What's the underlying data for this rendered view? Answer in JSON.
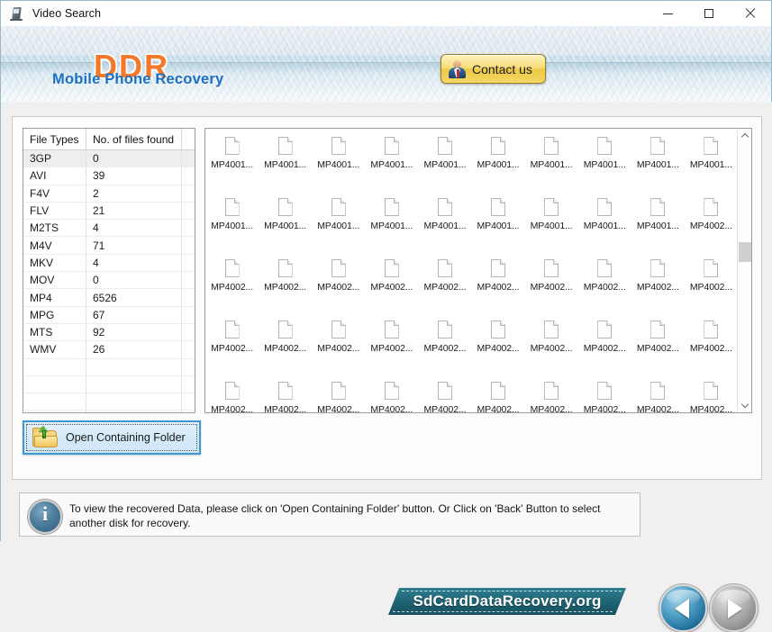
{
  "window": {
    "title": "Video Search",
    "icon": "video-search-icon",
    "controls": {
      "minimize": "minimize",
      "maximize": "maximize",
      "close": "close"
    }
  },
  "header": {
    "logo": "DDR",
    "subtitle": "Mobile Phone Recovery",
    "contact_label": "Contact us",
    "accent_orange": "#f4782a",
    "accent_blue": "#1a6fc4"
  },
  "file_table": {
    "columns": [
      "File Types",
      "No. of files found",
      ""
    ],
    "rows": [
      {
        "type": "3GP",
        "count": "0",
        "selected": true
      },
      {
        "type": "AVI",
        "count": "39",
        "selected": false
      },
      {
        "type": "F4V",
        "count": "2",
        "selected": false
      },
      {
        "type": "FLV",
        "count": "21",
        "selected": false
      },
      {
        "type": "M2TS",
        "count": "4",
        "selected": false
      },
      {
        "type": "M4V",
        "count": "71",
        "selected": false
      },
      {
        "type": "MKV",
        "count": "4",
        "selected": false
      },
      {
        "type": "MOV",
        "count": "0",
        "selected": false
      },
      {
        "type": "MP4",
        "count": "6526",
        "selected": false
      },
      {
        "type": "MPG",
        "count": "67",
        "selected": false
      },
      {
        "type": "MTS",
        "count": "92",
        "selected": false
      },
      {
        "type": "WMV",
        "count": "26",
        "selected": false
      }
    ],
    "empty_rows": 6
  },
  "open_folder_button": {
    "label": "Open Containing Folder",
    "icon": "open-folder-icon"
  },
  "file_grid": {
    "columns": 10,
    "names": [
      "MP4001...",
      "MP4001...",
      "MP4001...",
      "MP4001...",
      "MP4001...",
      "MP4001...",
      "MP4001...",
      "MP4001...",
      "MP4001...",
      "MP4001...",
      "MP4001...",
      "MP4001...",
      "MP4001...",
      "MP4001...",
      "MP4001...",
      "MP4001...",
      "MP4001...",
      "MP4001...",
      "MP4001...",
      "MP4002...",
      "MP4002...",
      "MP4002...",
      "MP4002...",
      "MP4002...",
      "MP4002...",
      "MP4002...",
      "MP4002...",
      "MP4002...",
      "MP4002...",
      "MP4002...",
      "MP4002...",
      "MP4002...",
      "MP4002...",
      "MP4002...",
      "MP4002...",
      "MP4002...",
      "MP4002...",
      "MP4002...",
      "MP4002...",
      "MP4002...",
      "MP4002...",
      "MP4002...",
      "MP4002...",
      "MP4002...",
      "MP4002...",
      "MP4002...",
      "MP4002...",
      "MP4002...",
      "MP4002...",
      "MP4002...",
      "MP4002...",
      "MP4002...",
      "MP4002...",
      "MP4002...",
      "MP4002...",
      "MP4002...",
      "MP4002...",
      "MP4002...",
      "MP4002...",
      "MP4002..."
    ],
    "scrollbar": {
      "up": "scroll-up",
      "down": "scroll-down",
      "thumb_position": "40%"
    }
  },
  "info": {
    "icon": "info-icon",
    "text": "To view the recovered Data, please click on 'Open Containing Folder' button. Or Click on 'Back' Button to select another disk for recovery."
  },
  "banner": {
    "text": "SdCardDataRecovery.org"
  },
  "navigation": {
    "back": "Back",
    "forward": "Next"
  }
}
